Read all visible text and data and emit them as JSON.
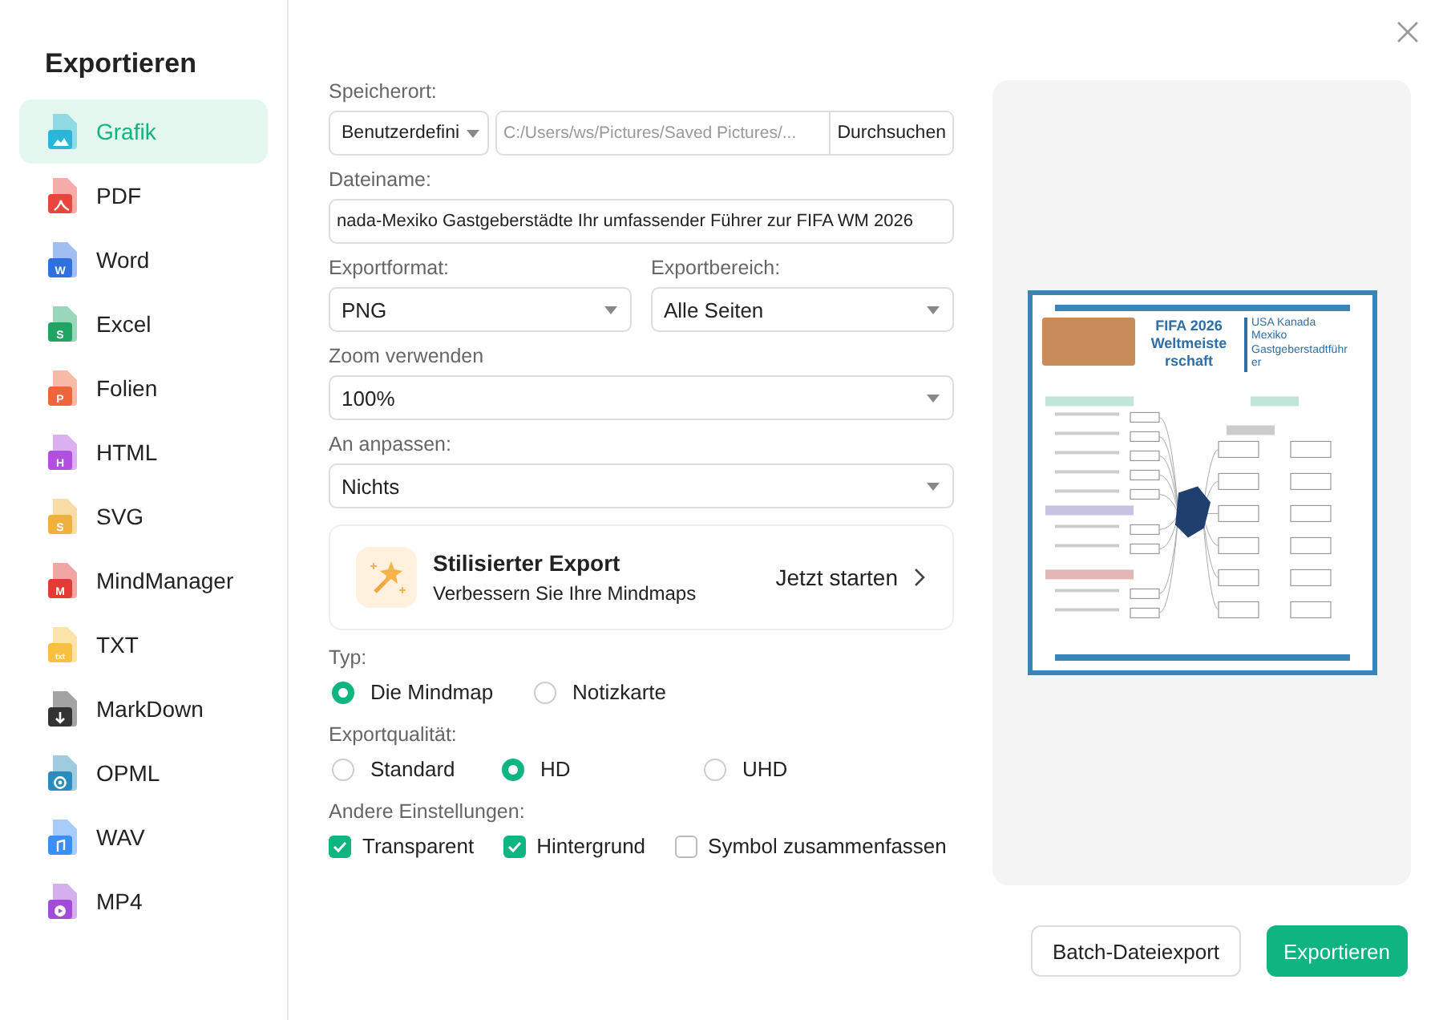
{
  "sidebar": {
    "title": "Exportieren",
    "items": [
      {
        "label": "Grafik",
        "selected": true,
        "kind": "image",
        "color": "#29b6d8"
      },
      {
        "label": "PDF",
        "selected": false,
        "kind": "pdf",
        "color": "#e8453c"
      },
      {
        "label": "Word",
        "selected": false,
        "kind": "letter",
        "glyph": "W",
        "color": "#2f6fe0"
      },
      {
        "label": "Excel",
        "selected": false,
        "kind": "letter",
        "glyph": "S",
        "color": "#1fa463"
      },
      {
        "label": "Folien",
        "selected": false,
        "kind": "letter",
        "glyph": "P",
        "color": "#f0643c"
      },
      {
        "label": "HTML",
        "selected": false,
        "kind": "letter",
        "glyph": "H",
        "color": "#b04fe0"
      },
      {
        "label": "SVG",
        "selected": false,
        "kind": "letter",
        "glyph": "S",
        "color": "#f0b03c"
      },
      {
        "label": "MindManager",
        "selected": false,
        "kind": "letter",
        "glyph": "M",
        "color": "#e23a34"
      },
      {
        "label": "TXT",
        "selected": false,
        "kind": "letter",
        "glyph": "txt",
        "color": "#f7c040"
      },
      {
        "label": "MarkDown",
        "selected": false,
        "kind": "download",
        "color": "#333333"
      },
      {
        "label": "OPML",
        "selected": false,
        "kind": "target",
        "color": "#2a8bbd"
      },
      {
        "label": "WAV",
        "selected": false,
        "kind": "note",
        "color": "#3a8ff5"
      },
      {
        "label": "MP4",
        "selected": false,
        "kind": "play",
        "color": "#a24bd8"
      }
    ]
  },
  "form": {
    "location": {
      "label": "Speicherort:",
      "mode": "Benutzerdefini",
      "path_placeholder": "C:/Users/ws/Pictures/Saved Pictures/...",
      "browse": "Durchsuchen"
    },
    "filename": {
      "label": "Dateiname:",
      "value": "nada-Mexiko Gastgeberstädte Ihr umfassender Führer zur FIFA WM 2026"
    },
    "format": {
      "label": "Exportformat:",
      "value": "PNG"
    },
    "range": {
      "label": "Exportbereich:",
      "value": "Alle Seiten"
    },
    "zoom": {
      "label": "Zoom verwenden",
      "value": "100%"
    },
    "fit": {
      "label": "An anpassen:",
      "value": "Nichts"
    },
    "promo": {
      "title": "Stilisierter Export",
      "subtitle": "Verbessern Sie Ihre Mindmaps",
      "action": "Jetzt starten"
    },
    "type": {
      "label": "Typ:",
      "options": [
        {
          "label": "Die Mindmap",
          "selected": true
        },
        {
          "label": "Notizkarte",
          "selected": false
        }
      ]
    },
    "quality": {
      "label": "Exportqualität:",
      "options": [
        {
          "label": "Standard",
          "selected": false
        },
        {
          "label": "HD",
          "selected": true
        },
        {
          "label": "UHD",
          "selected": false
        }
      ]
    },
    "other": {
      "label": "Andere Einstellungen:",
      "options": [
        {
          "label": "Transparent",
          "checked": true
        },
        {
          "label": "Hintergrund",
          "checked": true
        },
        {
          "label": "Symbol zusammenfassen",
          "checked": false
        }
      ]
    }
  },
  "preview": {
    "title": "FIFA 2026 Weltmeiste rschaft",
    "subtitle": "USA Kanada Mexiko Gastgeberstadtführ er"
  },
  "buttons": {
    "secondary": "Batch-Dateiexport",
    "primary": "Exportieren"
  }
}
